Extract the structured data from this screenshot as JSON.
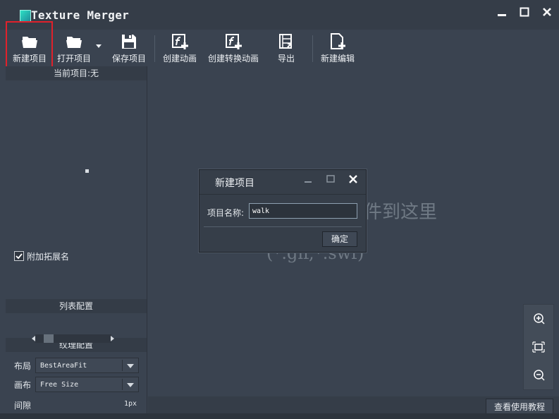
{
  "window": {
    "title": "Texture Merger"
  },
  "toolbar": {
    "new_project": "新建项目",
    "open_project": "打开项目",
    "save_project": "保存项目",
    "create_animation": "创建动画",
    "create_convert_animation": "创建转换动画",
    "export": "导出",
    "new_edit": "新建编辑"
  },
  "left_panel": {
    "current_project": "当前项目:无",
    "list_config": "列表配置",
    "append_extension": "附加拓展名",
    "append_extension_checked": true,
    "texture_config": "纹理配置",
    "layout_label": "布局",
    "layout_value": "BestAreaFit",
    "canvas_label": "画布",
    "canvas_value": "Free Size",
    "spacing_label": "间隙",
    "spacing_value": "1px"
  },
  "main": {
    "drop_hint_line1": "件到这里",
    "drop_hint_line2": "(*.gif,*.swf)"
  },
  "dialog": {
    "title": "新建项目",
    "name_label": "项目名称:",
    "name_value": "walk",
    "ok_button": "确定"
  },
  "status": {
    "help_button": "查看使用教程"
  },
  "colors": {
    "background": "#3a4350",
    "highlight": "#e0212b",
    "title_text": "#f0f2f4"
  }
}
